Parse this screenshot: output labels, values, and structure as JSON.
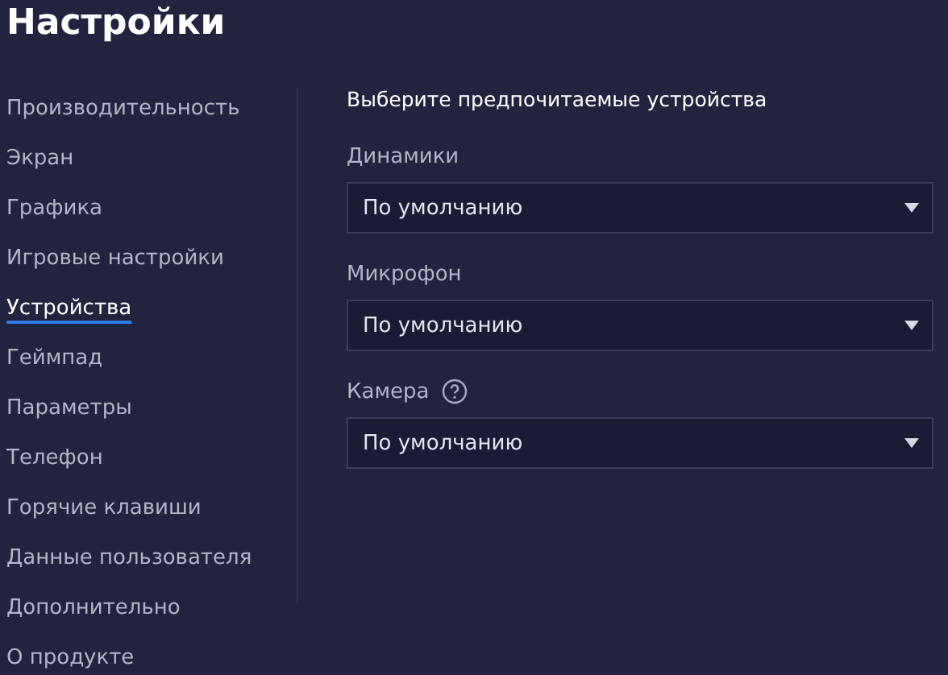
{
  "title": "Настройки",
  "sidebar": {
    "items": [
      {
        "label": "Производительность",
        "selected": false
      },
      {
        "label": "Экран",
        "selected": false
      },
      {
        "label": "Графика",
        "selected": false
      },
      {
        "label": "Игровые настройки",
        "selected": false
      },
      {
        "label": "Устройства",
        "selected": true
      },
      {
        "label": "Геймпад",
        "selected": false
      },
      {
        "label": "Параметры",
        "selected": false
      },
      {
        "label": "Телефон",
        "selected": false
      },
      {
        "label": "Горячие клавиши",
        "selected": false
      },
      {
        "label": "Данные пользователя",
        "selected": false
      },
      {
        "label": "Дополнительно",
        "selected": false
      },
      {
        "label": "О продукте",
        "selected": false
      }
    ]
  },
  "content": {
    "heading": "Выберите предпочитаемые устройства",
    "devices": [
      {
        "label": "Динамики",
        "help": false,
        "value": "По умолчанию"
      },
      {
        "label": "Микрофон",
        "help": false,
        "value": "По умолчанию"
      },
      {
        "label": "Камера",
        "help": true,
        "value": "По умолчанию"
      }
    ]
  }
}
